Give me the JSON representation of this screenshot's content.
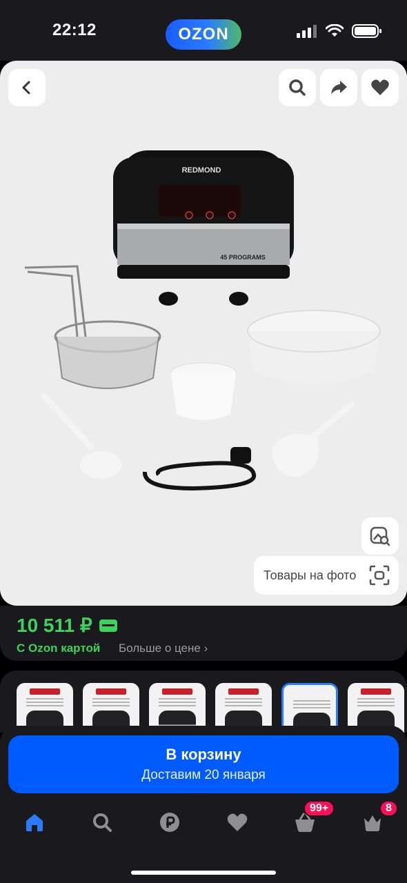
{
  "status_bar": {
    "time": "22:12",
    "logo_text": "OZON"
  },
  "photo": {
    "back_icon": "chevron-left-icon",
    "search_icon": "search-icon",
    "share_icon": "share-icon",
    "favorite_icon": "heart-icon",
    "visual_search_icon": "image-search-icon",
    "product_brand": "REDMOND",
    "product_badge": "45 PROGRAMS",
    "products_on_photo_label": "Товары на фото"
  },
  "price": {
    "value": "10 511 ₽",
    "ozon_card_label": "С Ozon картой",
    "more_label": "Больше о цене ›",
    "accent_color": "#3dd25c"
  },
  "thumbnails": [
    {
      "id": 1,
      "active": false
    },
    {
      "id": 2,
      "active": false
    },
    {
      "id": 3,
      "active": false
    },
    {
      "id": 4,
      "active": false
    },
    {
      "id": 5,
      "active": true
    },
    {
      "id": 6,
      "active": false
    }
  ],
  "cart": {
    "button_label": "В корзину",
    "delivery_label": "Доставим 20 января",
    "color": "#005bff"
  },
  "tabbar": {
    "items": [
      {
        "icon": "home-icon",
        "active": true
      },
      {
        "icon": "search-icon",
        "active": false
      },
      {
        "icon": "ruble-icon",
        "active": false
      },
      {
        "icon": "heart-icon",
        "active": false
      },
      {
        "icon": "cart-icon",
        "active": false,
        "badge": "99+"
      },
      {
        "icon": "profile-icon",
        "active": false,
        "badge": "8"
      }
    ]
  }
}
